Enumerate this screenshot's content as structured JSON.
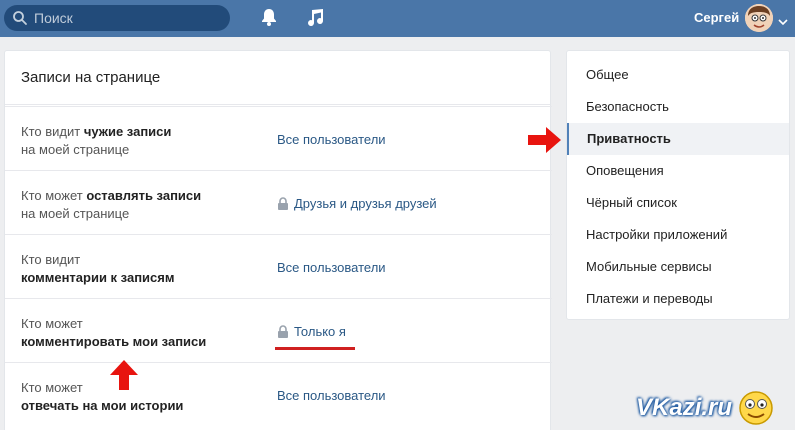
{
  "header": {
    "search_placeholder": "Поиск",
    "username": "Сергей",
    "icons": [
      "search-icon",
      "bell-icon",
      "music-icon",
      "avatar",
      "chevron-down-icon"
    ],
    "bar_color": "#4a76a8"
  },
  "main": {
    "section_title": "Записи на странице",
    "rows": [
      {
        "label_pre": "Кто видит ",
        "label_bold": "чужие записи",
        "label_post": "на моей странице",
        "value": "Все пользователи",
        "locked": false
      },
      {
        "label_pre": "Кто может ",
        "label_bold": "оставлять записи",
        "label_post": "на моей странице",
        "value": "Друзья и друзья друзей",
        "locked": true
      },
      {
        "label_pre": "Кто видит",
        "label_bold": "комментарии к записям",
        "label_post": "",
        "value": "Все пользователи",
        "locked": false
      },
      {
        "label_pre": "Кто может",
        "label_bold": "комментировать мои записи",
        "label_post": "",
        "value": "Только я",
        "locked": true
      },
      {
        "label_pre": "Кто может",
        "label_bold": "отвечать на мои истории",
        "label_post": "",
        "value": "Все пользователи",
        "locked": false
      }
    ]
  },
  "menu": {
    "items": [
      "Общее",
      "Безопасность",
      "Приватность",
      "Оповещения",
      "Чёрный список",
      "Настройки приложений",
      "Мобильные сервисы",
      "Платежи и переводы"
    ],
    "active_index": 2,
    "accent": "#5181b8"
  },
  "annotations": {
    "arrow_color": "#e8140f"
  },
  "watermark": {
    "text": "VKazi.ru"
  }
}
